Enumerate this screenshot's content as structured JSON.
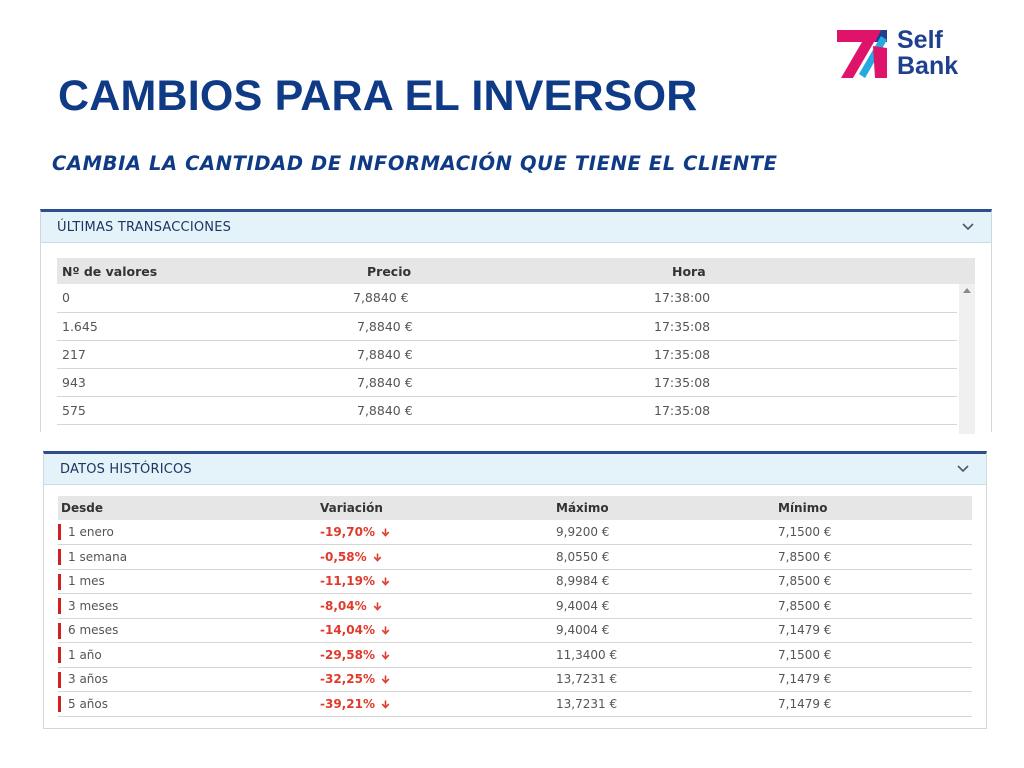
{
  "brand": {
    "line1": "Self",
    "line2": "Bank",
    "colors": {
      "blue": "#1f3f8f",
      "magenta": "#e0136b",
      "cyan": "#27a8e0"
    }
  },
  "slide": {
    "title": "CAMBIOS PARA EL INVERSOR",
    "subtitle": "CAMBIA LA CANTIDAD DE INFORMACIÓN QUE TIENE EL CLIENTE"
  },
  "transactions": {
    "header": "ÚLTIMAS TRANSACCIONES",
    "columns": [
      "Nº de valores",
      "Precio",
      "Hora"
    ],
    "rows": [
      [
        "0",
        "7,8840 €",
        "17:38:00"
      ],
      [
        "1.645",
        "7,8840 €",
        "17:35:08"
      ],
      [
        "217",
        "7,8840 €",
        "17:35:08"
      ],
      [
        "943",
        "7,8840 €",
        "17:35:08"
      ],
      [
        "575",
        "7,8840 €",
        "17:35:08"
      ]
    ]
  },
  "historical": {
    "header": "DATOS HISTÓRICOS",
    "columns": [
      "Desde",
      "Variación",
      "Máximo",
      "Mínimo"
    ],
    "rows": [
      [
        "1 enero",
        "-19,70%",
        "9,9200 €",
        "7,1500 €"
      ],
      [
        "1 semana",
        "-0,58%",
        "8,0550 €",
        "7,8500 €"
      ],
      [
        "1 mes",
        "-11,19%",
        "8,9984 €",
        "7,8500 €"
      ],
      [
        "3 meses",
        "-8,04%",
        "9,4004 €",
        "7,8500 €"
      ],
      [
        "6 meses",
        "-14,04%",
        "9,4004 €",
        "7,1479 €"
      ],
      [
        "1 año",
        "-29,58%",
        "11,3400 €",
        "7,1500 €"
      ],
      [
        "3 años",
        "-32,25%",
        "13,7231 €",
        "7,1479 €"
      ],
      [
        "5 años",
        "-39,21%",
        "13,7231 €",
        "7,1479 €"
      ]
    ]
  },
  "colors": {
    "title": "#0e3a86",
    "header_bg": "#e4f2f9",
    "negative": "#e03a2a",
    "panel_border": "#2b4f8e"
  },
  "icons": [
    "chevron-down-icon",
    "scroll-up-icon",
    "arrow-down-icon"
  ]
}
